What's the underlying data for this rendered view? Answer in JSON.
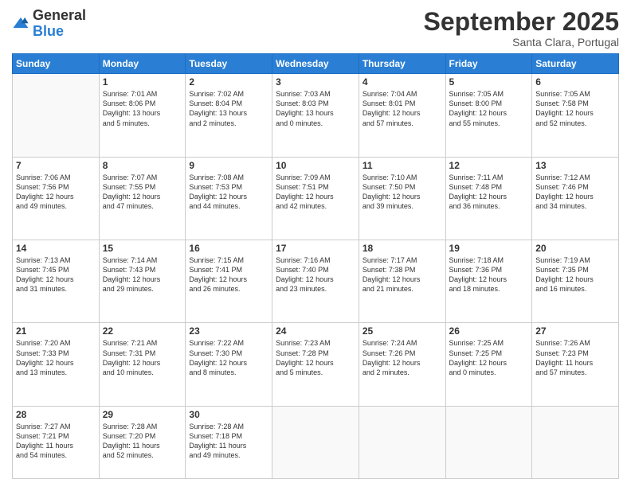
{
  "header": {
    "logo_general": "General",
    "logo_blue": "Blue",
    "month": "September 2025",
    "location": "Santa Clara, Portugal"
  },
  "weekdays": [
    "Sunday",
    "Monday",
    "Tuesday",
    "Wednesday",
    "Thursday",
    "Friday",
    "Saturday"
  ],
  "weeks": [
    [
      {
        "day": "",
        "content": ""
      },
      {
        "day": "1",
        "content": "Sunrise: 7:01 AM\nSunset: 8:06 PM\nDaylight: 13 hours\nand 5 minutes."
      },
      {
        "day": "2",
        "content": "Sunrise: 7:02 AM\nSunset: 8:04 PM\nDaylight: 13 hours\nand 2 minutes."
      },
      {
        "day": "3",
        "content": "Sunrise: 7:03 AM\nSunset: 8:03 PM\nDaylight: 13 hours\nand 0 minutes."
      },
      {
        "day": "4",
        "content": "Sunrise: 7:04 AM\nSunset: 8:01 PM\nDaylight: 12 hours\nand 57 minutes."
      },
      {
        "day": "5",
        "content": "Sunrise: 7:05 AM\nSunset: 8:00 PM\nDaylight: 12 hours\nand 55 minutes."
      },
      {
        "day": "6",
        "content": "Sunrise: 7:05 AM\nSunset: 7:58 PM\nDaylight: 12 hours\nand 52 minutes."
      }
    ],
    [
      {
        "day": "7",
        "content": "Sunrise: 7:06 AM\nSunset: 7:56 PM\nDaylight: 12 hours\nand 49 minutes."
      },
      {
        "day": "8",
        "content": "Sunrise: 7:07 AM\nSunset: 7:55 PM\nDaylight: 12 hours\nand 47 minutes."
      },
      {
        "day": "9",
        "content": "Sunrise: 7:08 AM\nSunset: 7:53 PM\nDaylight: 12 hours\nand 44 minutes."
      },
      {
        "day": "10",
        "content": "Sunrise: 7:09 AM\nSunset: 7:51 PM\nDaylight: 12 hours\nand 42 minutes."
      },
      {
        "day": "11",
        "content": "Sunrise: 7:10 AM\nSunset: 7:50 PM\nDaylight: 12 hours\nand 39 minutes."
      },
      {
        "day": "12",
        "content": "Sunrise: 7:11 AM\nSunset: 7:48 PM\nDaylight: 12 hours\nand 36 minutes."
      },
      {
        "day": "13",
        "content": "Sunrise: 7:12 AM\nSunset: 7:46 PM\nDaylight: 12 hours\nand 34 minutes."
      }
    ],
    [
      {
        "day": "14",
        "content": "Sunrise: 7:13 AM\nSunset: 7:45 PM\nDaylight: 12 hours\nand 31 minutes."
      },
      {
        "day": "15",
        "content": "Sunrise: 7:14 AM\nSunset: 7:43 PM\nDaylight: 12 hours\nand 29 minutes."
      },
      {
        "day": "16",
        "content": "Sunrise: 7:15 AM\nSunset: 7:41 PM\nDaylight: 12 hours\nand 26 minutes."
      },
      {
        "day": "17",
        "content": "Sunrise: 7:16 AM\nSunset: 7:40 PM\nDaylight: 12 hours\nand 23 minutes."
      },
      {
        "day": "18",
        "content": "Sunrise: 7:17 AM\nSunset: 7:38 PM\nDaylight: 12 hours\nand 21 minutes."
      },
      {
        "day": "19",
        "content": "Sunrise: 7:18 AM\nSunset: 7:36 PM\nDaylight: 12 hours\nand 18 minutes."
      },
      {
        "day": "20",
        "content": "Sunrise: 7:19 AM\nSunset: 7:35 PM\nDaylight: 12 hours\nand 16 minutes."
      }
    ],
    [
      {
        "day": "21",
        "content": "Sunrise: 7:20 AM\nSunset: 7:33 PM\nDaylight: 12 hours\nand 13 minutes."
      },
      {
        "day": "22",
        "content": "Sunrise: 7:21 AM\nSunset: 7:31 PM\nDaylight: 12 hours\nand 10 minutes."
      },
      {
        "day": "23",
        "content": "Sunrise: 7:22 AM\nSunset: 7:30 PM\nDaylight: 12 hours\nand 8 minutes."
      },
      {
        "day": "24",
        "content": "Sunrise: 7:23 AM\nSunset: 7:28 PM\nDaylight: 12 hours\nand 5 minutes."
      },
      {
        "day": "25",
        "content": "Sunrise: 7:24 AM\nSunset: 7:26 PM\nDaylight: 12 hours\nand 2 minutes."
      },
      {
        "day": "26",
        "content": "Sunrise: 7:25 AM\nSunset: 7:25 PM\nDaylight: 12 hours\nand 0 minutes."
      },
      {
        "day": "27",
        "content": "Sunrise: 7:26 AM\nSunset: 7:23 PM\nDaylight: 11 hours\nand 57 minutes."
      }
    ],
    [
      {
        "day": "28",
        "content": "Sunrise: 7:27 AM\nSunset: 7:21 PM\nDaylight: 11 hours\nand 54 minutes."
      },
      {
        "day": "29",
        "content": "Sunrise: 7:28 AM\nSunset: 7:20 PM\nDaylight: 11 hours\nand 52 minutes."
      },
      {
        "day": "30",
        "content": "Sunrise: 7:28 AM\nSunset: 7:18 PM\nDaylight: 11 hours\nand 49 minutes."
      },
      {
        "day": "",
        "content": ""
      },
      {
        "day": "",
        "content": ""
      },
      {
        "day": "",
        "content": ""
      },
      {
        "day": "",
        "content": ""
      }
    ]
  ]
}
